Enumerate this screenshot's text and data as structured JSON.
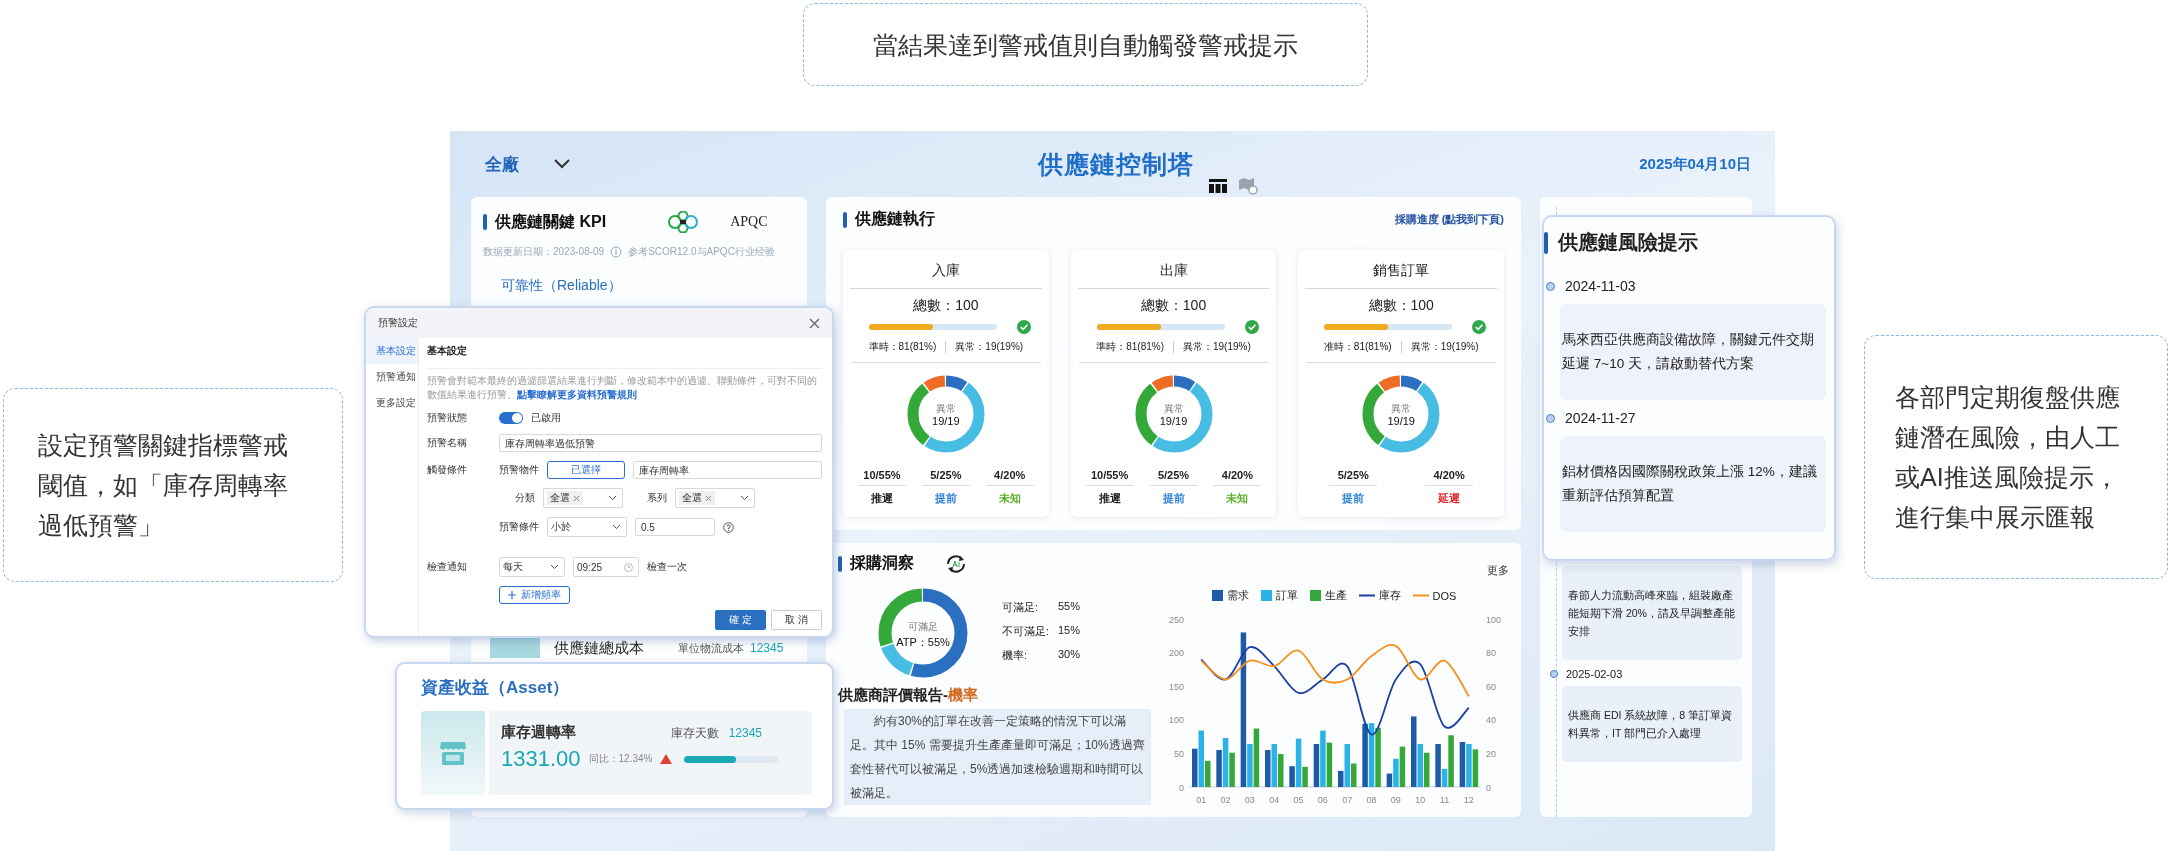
{
  "callout_top": {
    "text": "當結果達到警戒值則自動觸發警戒提示"
  },
  "callout_left": {
    "text": "設定預警關鍵指標警戒閾值，如「庫存周轉率過低預警」"
  },
  "callout_right": {
    "text": "各部門定期復盤供應鏈潛在風險，由人工或AI推送風險提示，進行集中展示匯報"
  },
  "header": {
    "plant_select": "全廠",
    "title": "供應鏈控制塔",
    "date": "2025年04月10日"
  },
  "kpi_panel": {
    "title": "供應鏈關鍵 KPI",
    "logo_text": "APQC",
    "update_date": "数据更新日期：2023-08-09",
    "reference": "参考SCOR12.0与APQC行业经验",
    "section": "可靠性（Reliable）",
    "cost_label": "供應鏈總成本",
    "cost_metric_label": "單位物流成本",
    "cost_metric_value": "12345"
  },
  "execution": {
    "title": "供應鏈執行",
    "link": "採購進度 (點我到下頁)",
    "cards": [
      {
        "title": "入庫",
        "total": "總數：100",
        "level": 0.5,
        "on_time": "準時：81(81%)",
        "abnormal": "異常：19(19%)",
        "donut_label": "異常",
        "donut_value": "19/19",
        "stats": [
          {
            "value": "10/55%",
            "label": "推遲",
            "color": "#222222"
          },
          {
            "value": "5/25%",
            "label": "提前",
            "color": "#2a7fd6"
          },
          {
            "value": "4/20%",
            "label": "未知",
            "color": "#5bb026"
          }
        ]
      },
      {
        "title": "出庫",
        "total": "總數：100",
        "level": 0.5,
        "on_time": "準時：81(81%)",
        "abnormal": "異常：19(19%)",
        "donut_label": "異常",
        "donut_value": "19/19",
        "stats": [
          {
            "value": "10/55%",
            "label": "推遲",
            "color": "#222222"
          },
          {
            "value": "5/25%",
            "label": "提前",
            "color": "#2a7fd6"
          },
          {
            "value": "4/20%",
            "label": "未知",
            "color": "#5bb026"
          }
        ]
      },
      {
        "title": "銷售訂單",
        "total": "總數：100",
        "level": 0.5,
        "on_time": "准時：81(81%)",
        "abnormal": "異常：19(19%)",
        "donut_label": "異常",
        "donut_value": "19/19",
        "stats": [
          {
            "value": "5/25%",
            "label": "提前",
            "color": "#2a7fd6"
          },
          {
            "value": "4/20%",
            "label": "延遲",
            "color": "#e8262c"
          }
        ]
      }
    ]
  },
  "procurement": {
    "title": "採購洞察",
    "more": "更多",
    "atp_label": "可滿足",
    "atp_value": "ATP：55%",
    "legend": [
      {
        "label": "可滿足:",
        "value": "55%"
      },
      {
        "label": "不可滿足:",
        "value": "15%"
      },
      {
        "label": "機率:",
        "value": "30%"
      }
    ],
    "report_title": "供應商評價報告-",
    "report_title_accent": "機率",
    "report_text": "約有30%的訂單在改善一定策略的情況下可以滿足。其中 15% 需要提升生產產量即可滿足；10%透過齊套性替代可以被滿足，5%透過加速檢驗週期和時間可以被滿足。",
    "chart_data": {
      "type": "bar",
      "stacked": false,
      "legend": "top",
      "categories": [
        "01",
        "02",
        "03",
        "04",
        "05",
        "06",
        "07",
        "08",
        "09",
        "10",
        "11",
        "12"
      ],
      "ylim": [
        0,
        250
      ],
      "yticks": [
        0,
        50,
        100,
        150,
        200,
        250
      ],
      "y2lim": [
        0,
        100
      ],
      "y2ticks": [
        0,
        20,
        40,
        60,
        80,
        100
      ],
      "series": [
        {
          "name": "需求",
          "type": "bar",
          "color": "#1f5aa8",
          "values": [
            57,
            55,
            230,
            55,
            31,
            64,
            24,
            94,
            20,
            105,
            64,
            67
          ]
        },
        {
          "name": "訂單",
          "type": "bar",
          "color": "#2bb3e8",
          "values": [
            84,
            73,
            64,
            64,
            72,
            84,
            64,
            95,
            42,
            64,
            27,
            64
          ]
        },
        {
          "name": "生產",
          "type": "bar",
          "color": "#35a83a",
          "values": [
            39,
            51,
            87,
            49,
            30,
            66,
            35,
            88,
            60,
            51,
            77,
            56
          ]
        },
        {
          "name": "庫存",
          "type": "line",
          "color": "#1b3fa6",
          "values": [
            190,
            160,
            208,
            180,
            140,
            160,
            180,
            78,
            160,
            183,
            90,
            118
          ]
        },
        {
          "name": "DOS",
          "type": "line",
          "color": "#f5901e",
          "values": [
            188,
            160,
            188,
            180,
            203,
            160,
            160,
            195,
            210,
            160,
            188,
            135
          ]
        }
      ]
    }
  },
  "risk_panel": {
    "items": [
      {
        "text": "春節人力流動高峰來臨，組裝廠產能短期下滑 20%，請及早調整產能安排"
      },
      {
        "date": "2025-02-03",
        "text": "供應商 EDI 系統故障，8 筆訂單資料異常，IT 部門已介入處理"
      }
    ]
  },
  "risk_card": {
    "title": "供應鏈風險提示",
    "items": [
      {
        "date": "2024-11-03",
        "text": "馬來西亞供應商設備故障，關鍵元件交期延遲 7~10 天，請啟動替代方案"
      },
      {
        "date": "2024-11-27",
        "text": "鋁材價格因國際關稅政策上漲 12%，建議重新評估預算配置"
      }
    ]
  },
  "dialog": {
    "title": "預警設定",
    "nav": [
      {
        "label": "基本設定",
        "selected": true
      },
      {
        "label": "預警通知",
        "selected": false
      },
      {
        "label": "更多設定",
        "selected": false
      }
    ],
    "section": "基本設定",
    "description": "預警會對範本最終的過濾篩選結果進行判斷，修改範本中的過濾、聯動條件，可對不同的數值結果進行預警。",
    "description_link": "點擊瞭解更多資料預警規則",
    "status_label": "預警狀態",
    "status_on": true,
    "status_text": "已啟用",
    "name_label": "預警名稱",
    "name_value": "庫存周轉率過低預警",
    "trigger_label": "觸發條件",
    "object_label": "預警物件",
    "object_button": "已選擇",
    "object_value": "庫存周轉率",
    "category_label": "分類",
    "category_tag": "全選",
    "series_label": "系列",
    "series_tag": "全選",
    "condition_label": "預警條件",
    "condition_value": "小於",
    "threshold_value": "0.5",
    "check_label": "檢查通知",
    "frequency_value": "每天",
    "time_value": "09:25",
    "check_suffix": "檢查一次",
    "add_button": "新增頻率",
    "ok_button": "確 定",
    "cancel_button": "取 消"
  },
  "asset": {
    "title": "資產收益（Asset）",
    "metric": "庫存週轉率",
    "days_label": "庫存天數",
    "days_value": "12345",
    "value": "1331.00",
    "yoy": "同比：12.34%",
    "level": 0.55
  }
}
